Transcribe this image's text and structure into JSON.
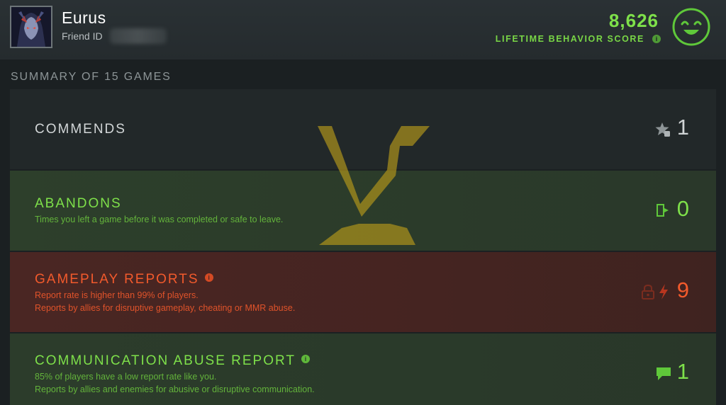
{
  "player": {
    "name": "Eurus",
    "friend_id_label": "Friend ID"
  },
  "behavior": {
    "score": "8,626",
    "label": "LIFETIME BEHAVIOR SCORE",
    "info_glyph": "i",
    "face_icon": "smiley-face-icon",
    "color": "#7ee04a"
  },
  "summary": {
    "title": "SUMMARY OF 15 GAMES"
  },
  "cards": {
    "commends": {
      "title": "COMMENDS",
      "count": "1",
      "icon": "star-thumbs-up-icon",
      "color": "#cfd3d4"
    },
    "abandons": {
      "title": "ABANDONS",
      "desc": "Times you left a game before it was completed or safe to leave.",
      "count": "0",
      "icon": "exit-door-icon",
      "color": "#7ee04a"
    },
    "gameplay": {
      "title": "GAMEPLAY REPORTS",
      "info_glyph": "i",
      "desc_1": "Report rate is higher than 99% of players.",
      "desc_2": "Reports by allies for disruptive gameplay, cheating or MMR abuse.",
      "count": "9",
      "icons": [
        "lock-icon",
        "lightning-bolt-icon"
      ],
      "color": "#f25a2c"
    },
    "communication": {
      "title": "COMMUNICATION ABUSE REPORT",
      "info_glyph": "i",
      "desc_1": "85% of players have a low report rate like you.",
      "desc_2": "Reports by allies and enemies for abusive or disruptive communication.",
      "count": "1",
      "icon": "chat-bubble-icon",
      "color": "#7ee04a"
    }
  }
}
